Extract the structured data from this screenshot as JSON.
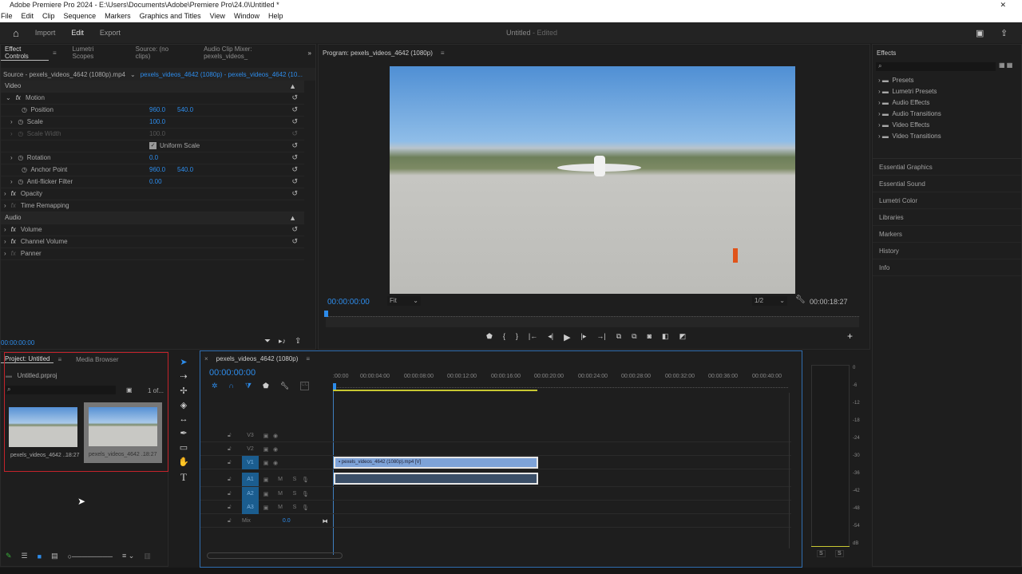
{
  "window": {
    "title": "Adobe Premiere Pro 2024 - E:\\Users\\Documents\\Adobe\\Premiere Pro\\24.0\\Untitled *",
    "close": "✕"
  },
  "menu": [
    "File",
    "Edit",
    "Clip",
    "Sequence",
    "Markers",
    "Graphics and Titles",
    "View",
    "Window",
    "Help"
  ],
  "header": {
    "import": "Import",
    "edit": "Edit",
    "export": "Export",
    "project_title": "Untitled",
    "status": "- Edited"
  },
  "effect_controls": {
    "tabs": [
      "Effect Controls",
      "Lumetri Scopes",
      "Source: (no clips)",
      "Audio Clip Mixer: pexels_videos_"
    ],
    "source": "Source - pexels_videos_4642 (1080p).mp4",
    "clip": "pexels_videos_4642 (1080p) - pexels_videos_4642 (10...",
    "video_label": "Video",
    "audio_label": "Audio",
    "rows": [
      {
        "name": "Motion",
        "fx": true,
        "v1": "",
        "v2": ""
      },
      {
        "name": "Position",
        "v1": "960.0",
        "v2": "540.0"
      },
      {
        "name": "Scale",
        "v1": "100.0",
        "v2": ""
      },
      {
        "name": "Scale Width",
        "v1": "100.0",
        "v2": "",
        "disabled": true
      },
      {
        "name": "",
        "v1": "Uniform Scale",
        "v2": ""
      },
      {
        "name": "Rotation",
        "v1": "0.0",
        "v2": ""
      },
      {
        "name": "Anchor Point",
        "v1": "960.0",
        "v2": "540.0"
      },
      {
        "name": "Anti-flicker Filter",
        "v1": "0.00",
        "v2": ""
      },
      {
        "name": "Opacity",
        "fx": true
      },
      {
        "name": "Time Remapping",
        "fx": true
      }
    ],
    "audio_rows": [
      "Volume",
      "Channel Volume",
      "Panner"
    ],
    "timecode": "00:00:00:00"
  },
  "program": {
    "title": "Program: pexels_videos_4642 (1080p)",
    "timecode": "00:00:00:00",
    "zoom": "Fit",
    "resolution": "1/2",
    "duration": "00:00:18:27"
  },
  "right_panel": {
    "effects_title": "Effects",
    "tree": [
      "Presets",
      "Lumetri Presets",
      "Audio Effects",
      "Audio Transitions",
      "Video Effects",
      "Video Transitions"
    ],
    "panels": [
      "Essential Graphics",
      "Essential Sound",
      "Lumetri Color",
      "Libraries",
      "Markers",
      "History",
      "Info"
    ]
  },
  "project": {
    "tabs": [
      "Project: Untitled",
      "Media Browser"
    ],
    "file": "Untitled.prproj",
    "count": "1 of...",
    "items": [
      {
        "name": "pexels_videos_4642 ...",
        "duration": "18:27"
      },
      {
        "name": "pexels_videos_4642 ...",
        "duration": "18:27"
      }
    ]
  },
  "timeline": {
    "title": "pexels_videos_4642 (1080p)",
    "timecode": "00:00:00:00",
    "ruler": [
      ":00:00",
      "00:00:04:00",
      "00:00:08:00",
      "00:00:12:00",
      "00:00:16:00",
      "00:00:20:00",
      "00:00:24:00",
      "00:00:28:00",
      "00:00:32:00",
      "00:00:36:00",
      "00:00:40:00"
    ],
    "video_tracks": [
      "V3",
      "V2",
      "V1"
    ],
    "audio_tracks": [
      "A1",
      "A2",
      "A3"
    ],
    "mix": "Mix",
    "mix_value": "0.0",
    "m": "M",
    "s": "S",
    "cc": "CC",
    "clip_label": "pexels_videos_4642 (1080p).mp4 [V]"
  },
  "meter": {
    "scale": [
      "0",
      "-6",
      "-12",
      "-18",
      "-24",
      "-30",
      "-36",
      "-42",
      "-48",
      "-54",
      "dB"
    ],
    "solo": "S"
  }
}
